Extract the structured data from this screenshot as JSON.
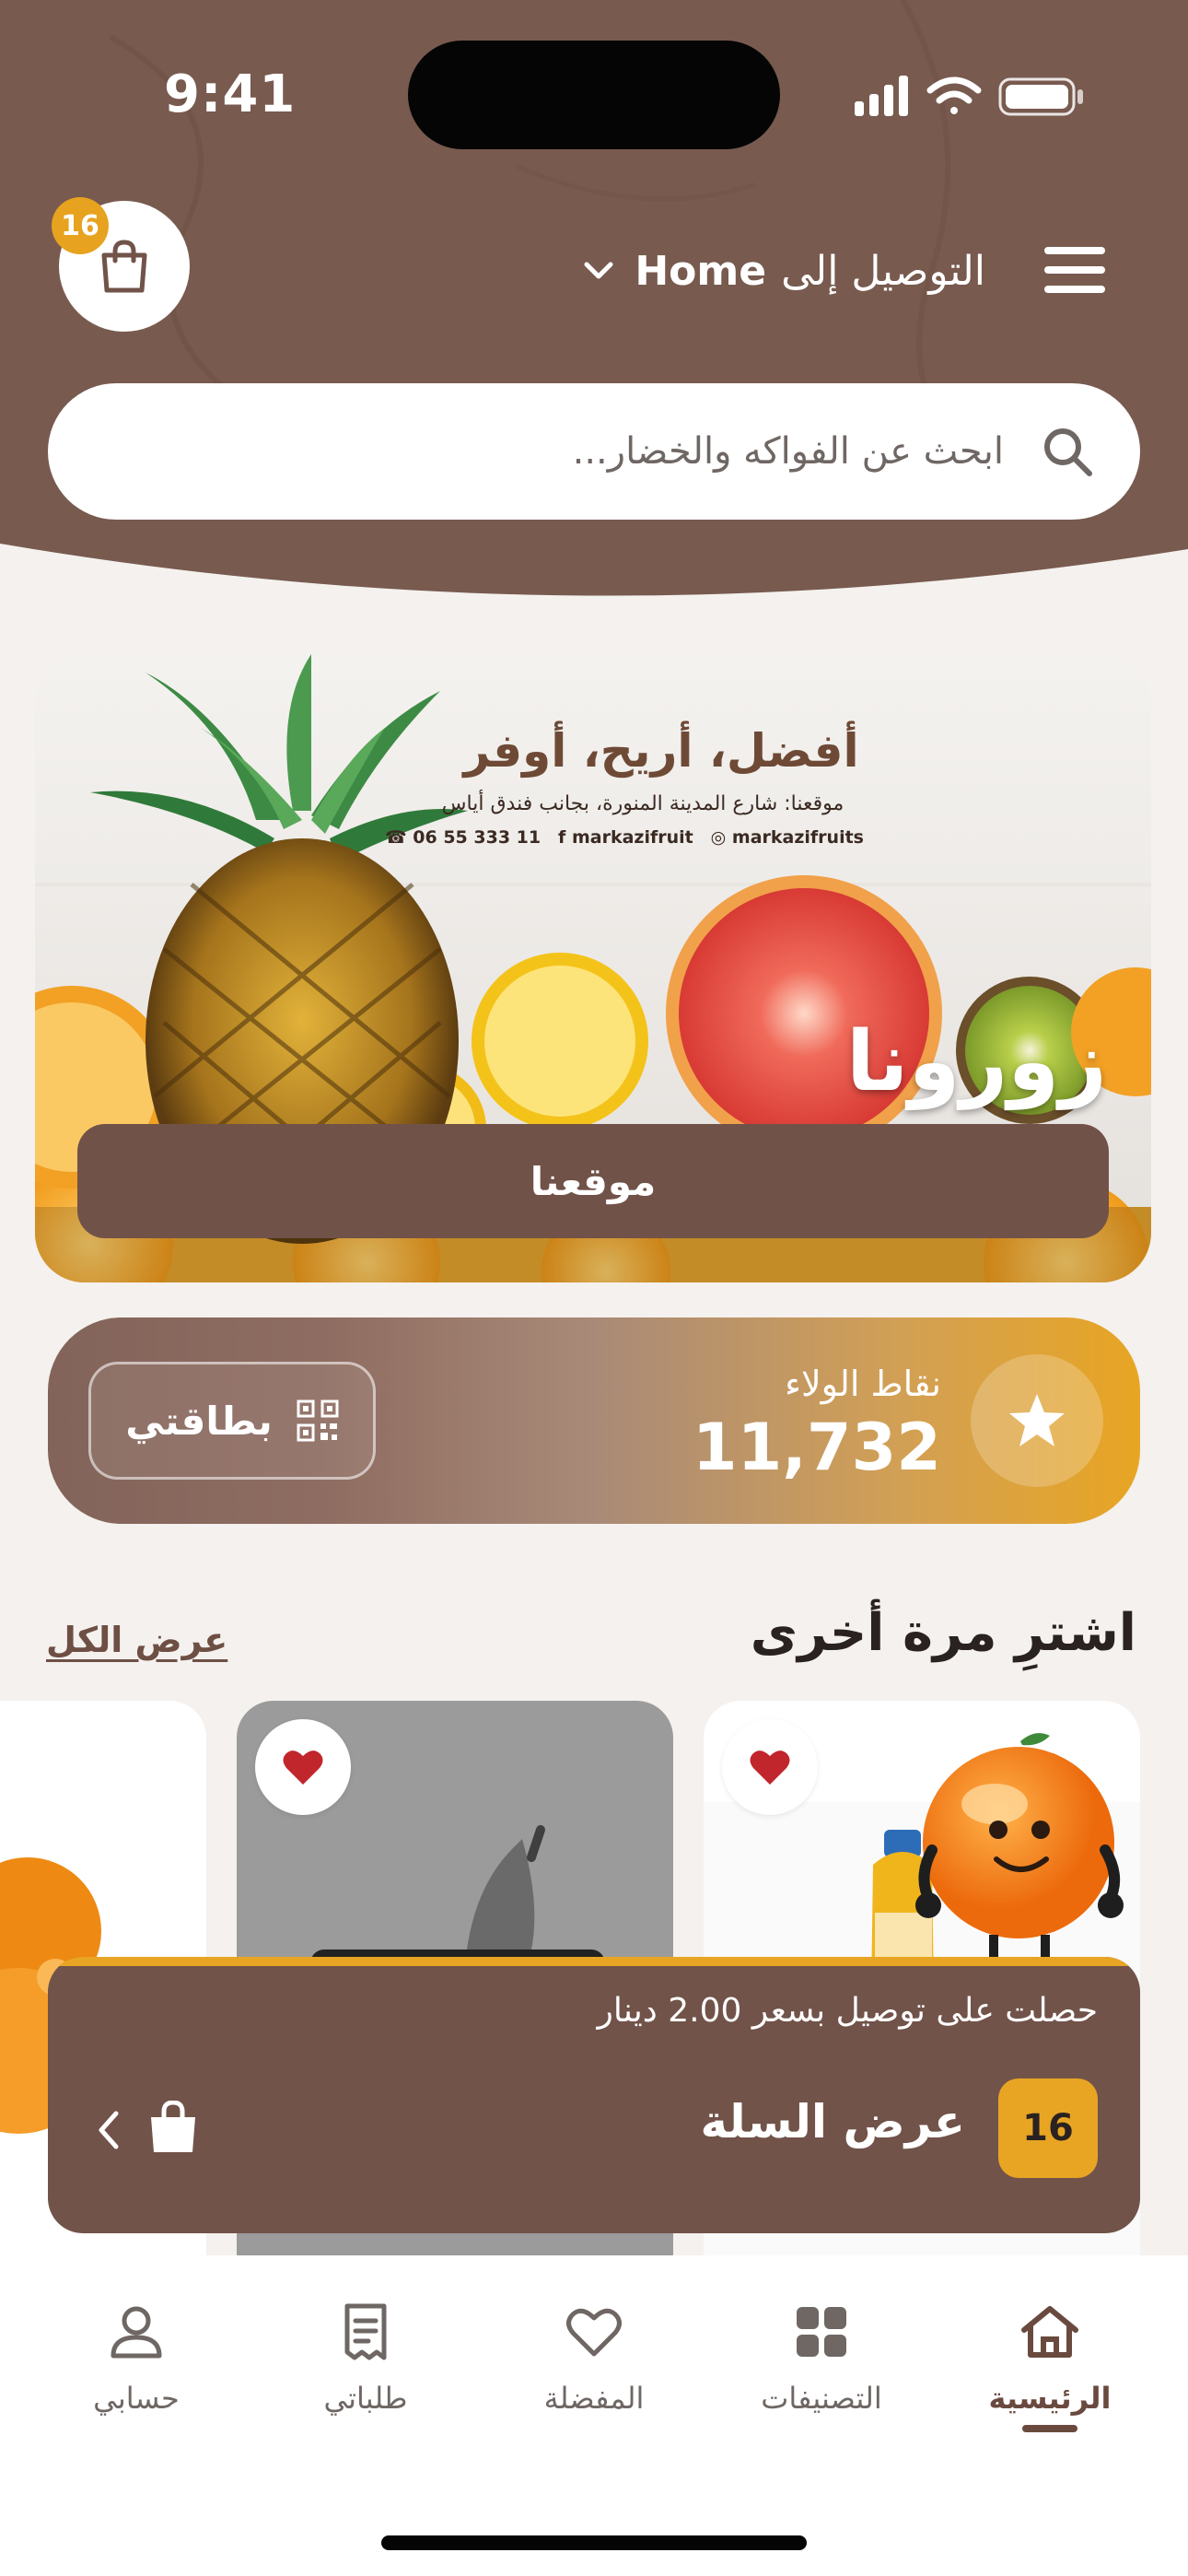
{
  "status_bar": {
    "time": "9:41"
  },
  "header": {
    "cart_count": "16",
    "deliver_label": "التوصيل إلى",
    "deliver_location": "Home",
    "search_placeholder": "ابحث عن الفواكه والخضار..."
  },
  "banner": {
    "tagline": "أفضل، أريح، أوفر",
    "location": "موقعنا: شارع المدينة المنورة، بجانب فندق أياس",
    "phone": "06 55 333 11",
    "facebook": "markazifruit",
    "instagram": "markazifruits",
    "visit_title": "زورونا",
    "button_label": "موقعنا"
  },
  "loyalty": {
    "label": "نقاط الولاء",
    "points": "11,732",
    "card_button": "بطاقتي"
  },
  "buy_again": {
    "title": "اشترِ مرة أخرى",
    "view_all": "عرض الكل"
  },
  "cart_bar": {
    "message": "حصلت على توصيل بسعر 2.00 دينار",
    "count": "16",
    "view_cart": "عرض السلة"
  },
  "tabs": [
    {
      "label": "الرئيسية",
      "icon": "home-icon",
      "active": true
    },
    {
      "label": "التصنيفات",
      "icon": "grid-icon",
      "active": false
    },
    {
      "label": "المفضلة",
      "icon": "heart-icon",
      "active": false
    },
    {
      "label": "طلباتي",
      "icon": "receipt-icon",
      "active": false
    },
    {
      "label": "حسابي",
      "icon": "person-icon",
      "active": false
    }
  ],
  "colors": {
    "brand_brown": "#715349",
    "accent_orange": "#e8a523",
    "background": "#f4f1ee"
  }
}
